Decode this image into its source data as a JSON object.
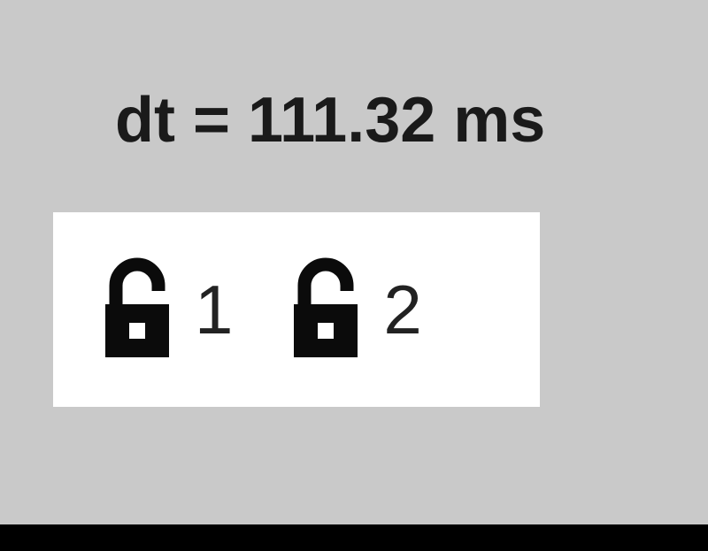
{
  "timing": {
    "label": "dt = 111.32 ms"
  },
  "locks": [
    {
      "label": "1",
      "state": "unlocked",
      "icon": "unlock-icon"
    },
    {
      "label": "2",
      "state": "unlocked",
      "icon": "unlock-icon"
    }
  ],
  "colors": {
    "background": "#c9c9c9",
    "panel": "#ffffff",
    "text": "#1a1a1a"
  }
}
